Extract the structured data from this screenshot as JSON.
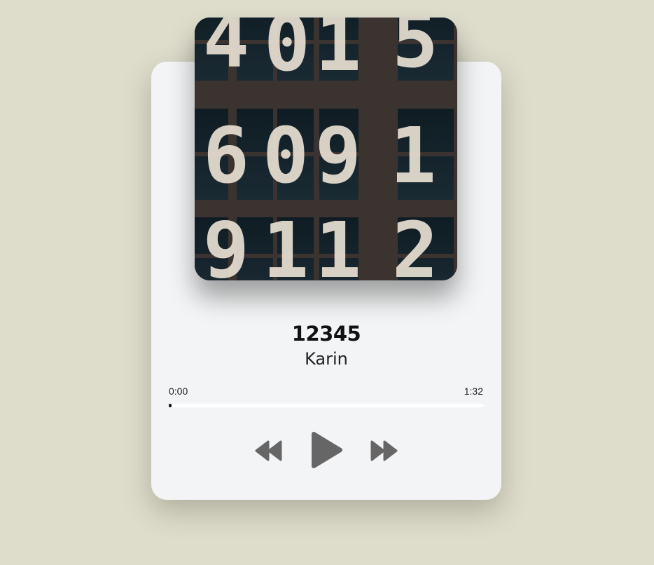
{
  "player": {
    "title": "12345",
    "artist": "Karin",
    "current_time": "0:00",
    "total_time": "1:32",
    "progress_fraction": 0.005,
    "cover_digits": [
      "4",
      "0",
      "1",
      "5",
      "6",
      "0",
      "9",
      "1",
      "9",
      "1",
      "1",
      "2"
    ]
  },
  "controls": {
    "rewind_icon": "rewind-icon",
    "play_icon": "play-icon",
    "forward_icon": "fast-forward-icon"
  },
  "colors": {
    "background": "#dedccb",
    "card": "#f3f4f5",
    "icon": "#666666",
    "progress": "#111111"
  }
}
